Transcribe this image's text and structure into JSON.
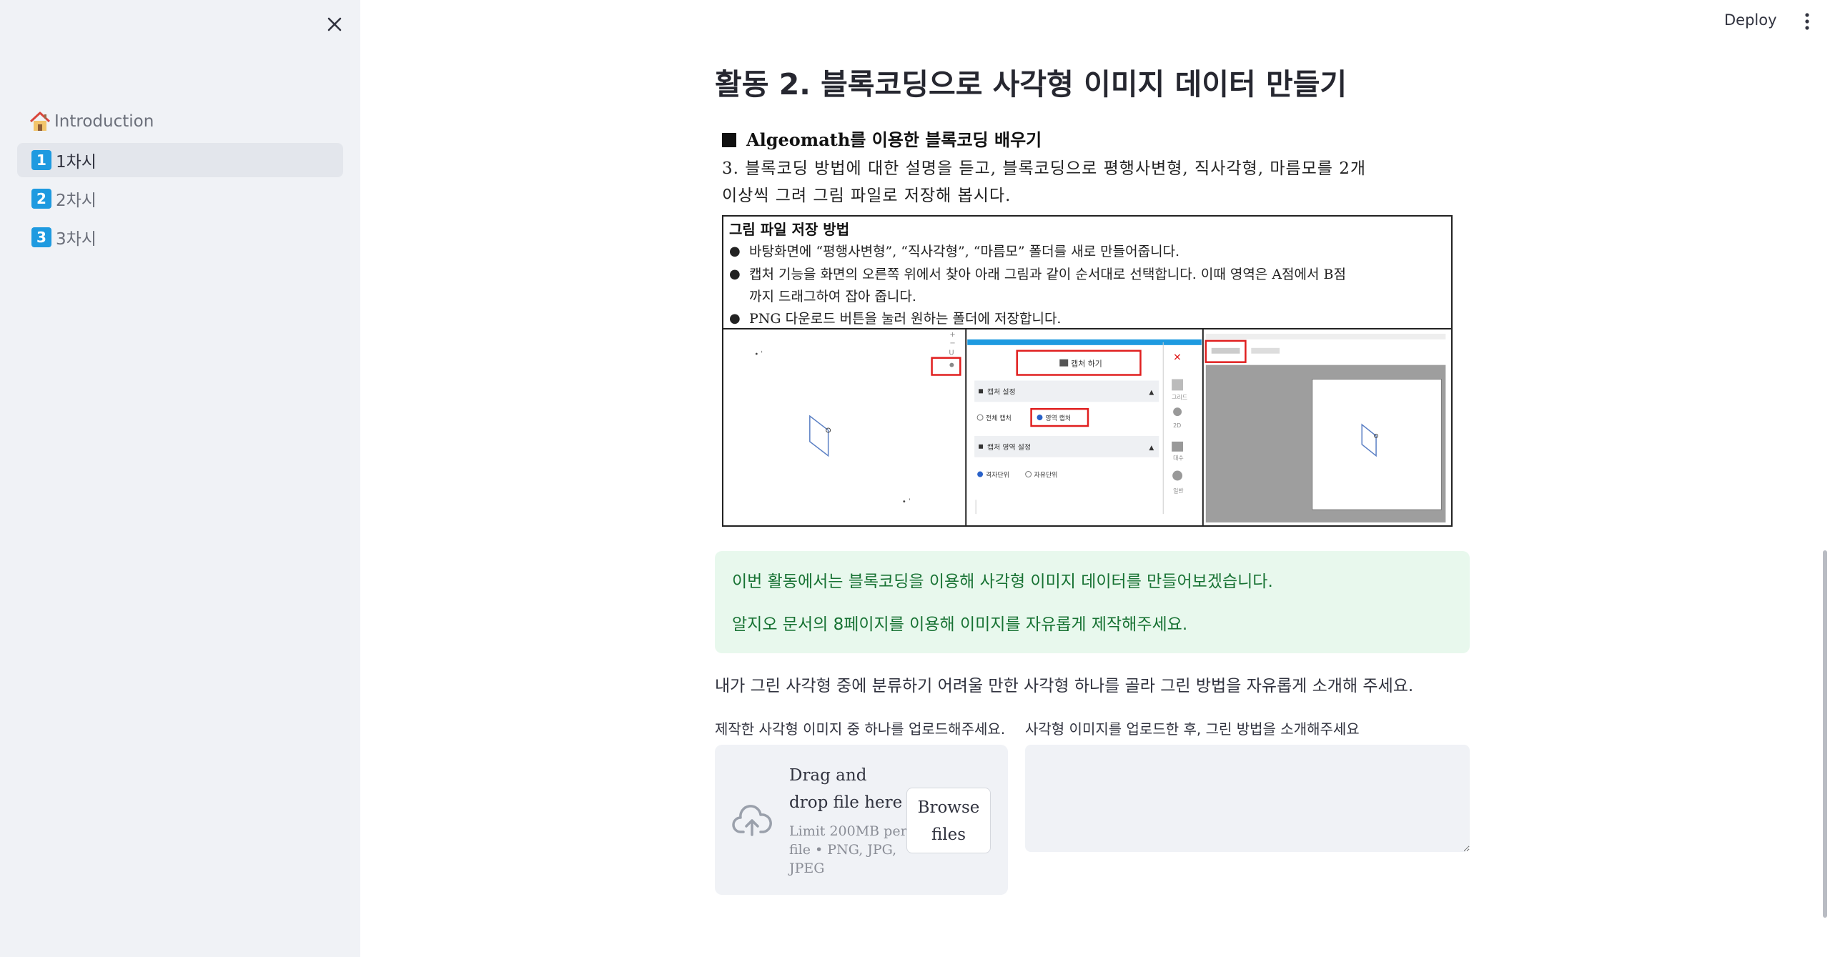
{
  "sidebar": {
    "items": [
      {
        "label": "Introduction",
        "icon": "house-icon"
      },
      {
        "badge": "1",
        "label": "1차시",
        "active": true
      },
      {
        "badge": "2",
        "label": "2차시"
      },
      {
        "badge": "3",
        "label": "3차시"
      }
    ]
  },
  "header": {
    "deploy_label": "Deploy"
  },
  "main": {
    "title": "활동 2. 블록코딩으로 사각형 이미지 데이터 만들기",
    "worksheet": {
      "heading": "Algeomath를 이용한 블록코딩 배우기",
      "instruction_line1": "3. 블록코딩 방법에 대한 설명을 듣고, 블록코딩으로 평행사변형, 직사각형, 마름모를 2개",
      "instruction_line2": "이상씩 그려 그림 파일로 저장해 봅시다.",
      "box_title": "그림 파일 저장 방법",
      "bullet1": "바탕화면에 “평행사변형”, “직사각형”, “마름모” 폴더를 새로 만들어줍니다.",
      "bullet2": "캡처 기능을 화면의 오른쪽 위에서 찾아 아래 그림과 같이 순서대로 선택합니다. 이때 영역은 A점에서 B점",
      "bullet2_cont": "까지 드래그하여 잡아 줍니다.",
      "bullet3": "PNG 다운로드 버튼을 눌러 원하는 폴더에 저장합니다.",
      "panel2": {
        "capture_btn": "캡처 하기",
        "capture_settings": "캡처 설정",
        "opt_full": "전체 캡처",
        "opt_area": "영역 캡처",
        "area_settings": "캡처 영역 설정",
        "opt_grid": "격자단위",
        "opt_free": "자유단위",
        "side_grid": "그리드",
        "side_2d": "2D",
        "side_alg": "대수",
        "side_gen": "일반"
      }
    },
    "info": {
      "line1": "이번 활동에서는 블록코딩을 이용해 사각형 이미지 데이터를 만들어보겠습니다.",
      "line2": "알지오 문서의 8페이지를 이용해 이미지를 자유롭게 제작해주세요."
    },
    "prompt": "내가 그린 사각형 중에 분류하기 어려울 만한 사각형 하나를 골라 그린 방법을 자유롭게 소개해 주세요.",
    "upload": {
      "label": "제작한 사각형 이미지 중 하나를 업로드해주세요.",
      "drag_text": "Drag and drop file here",
      "limit_text": "Limit 200MB per file • PNG, JPG, JPEG",
      "browse_label": "Browse files"
    },
    "description": {
      "label": "사각형 이미지를 업로드한 후, 그린 방법을 소개해주세요",
      "value": ""
    }
  },
  "colors": {
    "sidebar_bg": "#f0f2f6",
    "active_bg": "#e3e6ec",
    "badge": "#1e9ae0",
    "info_bg": "#e8f8ed",
    "info_text": "#177233",
    "capture_red": "#e01e1e"
  }
}
